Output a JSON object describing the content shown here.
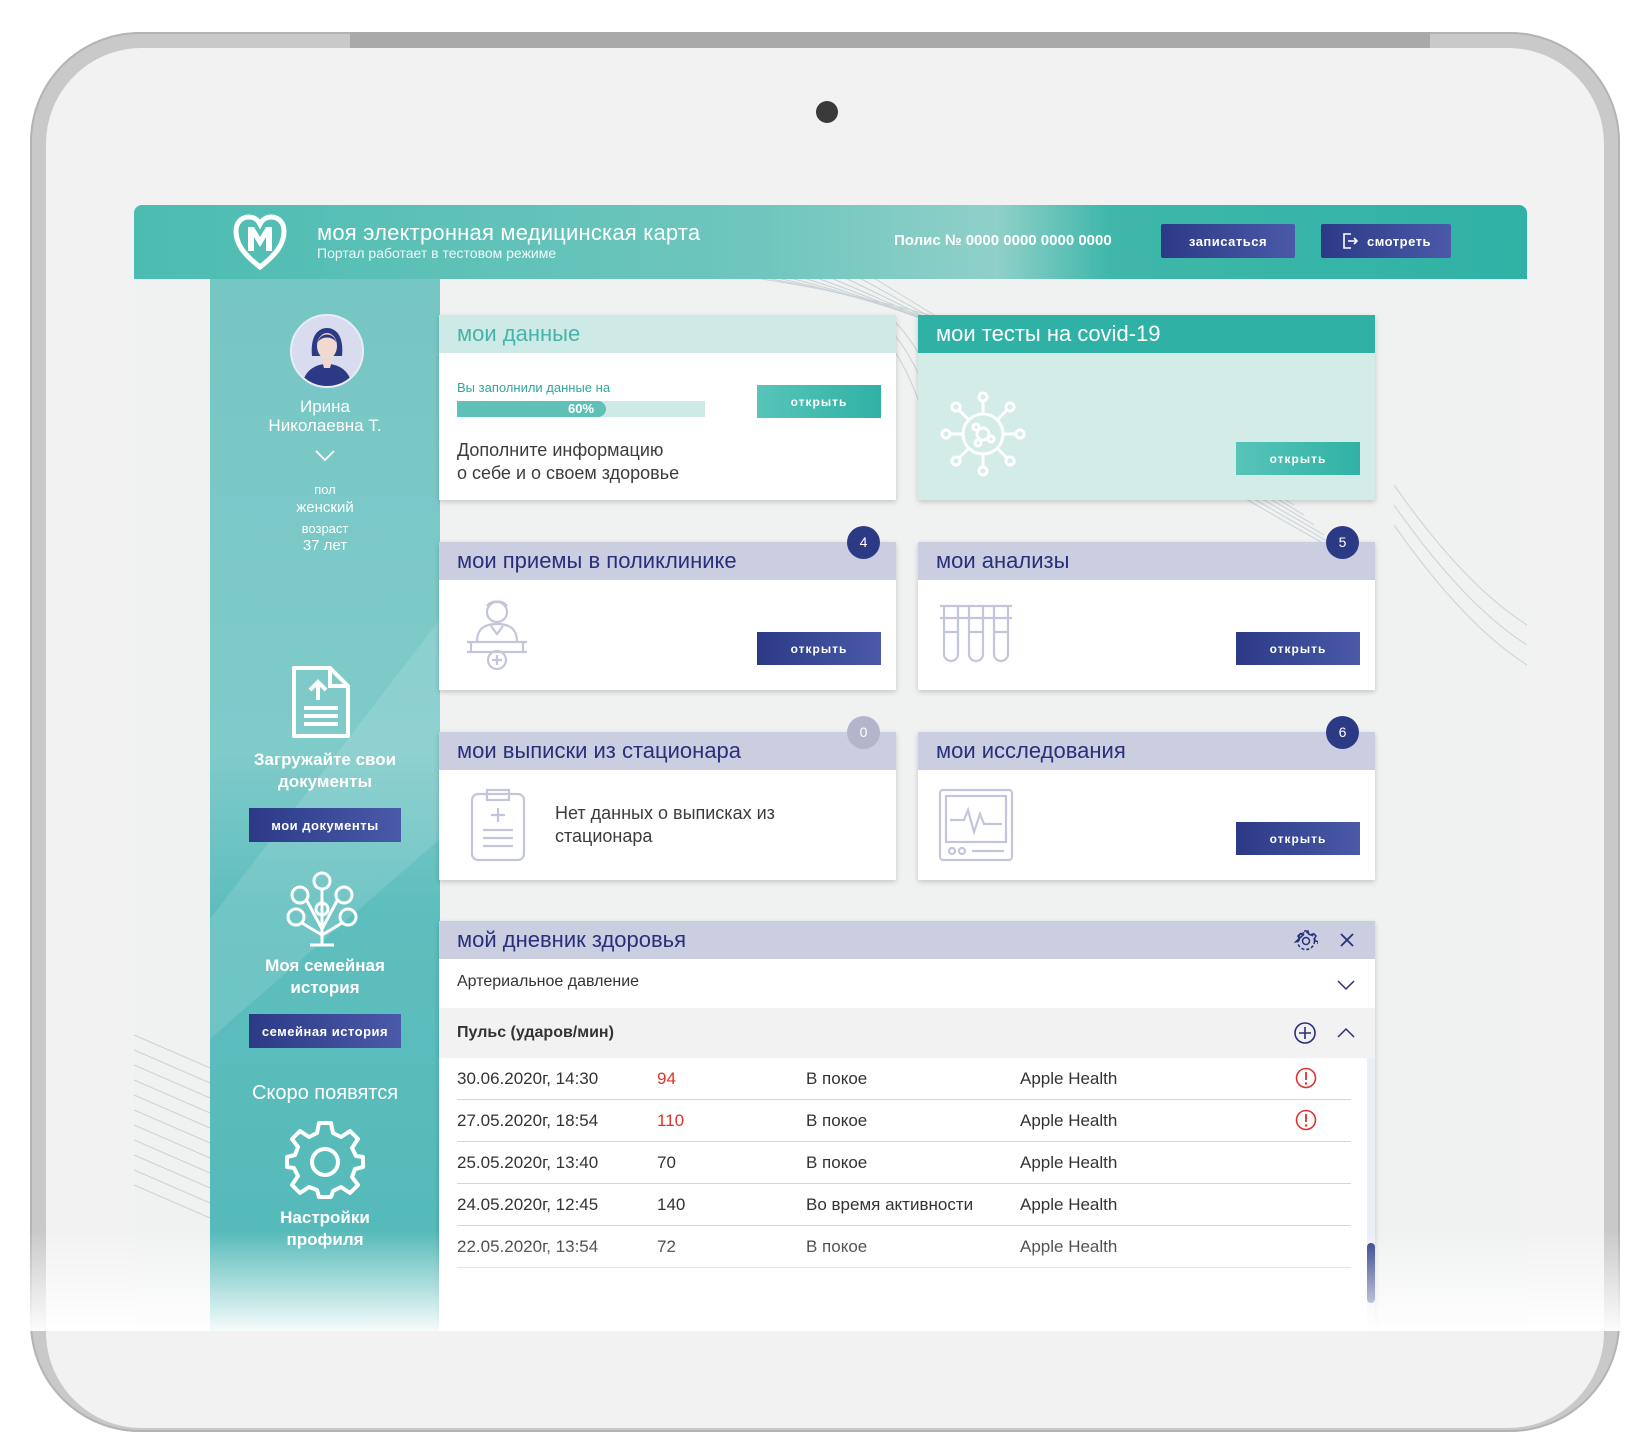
{
  "header": {
    "title": "моя электронная медицинская карта",
    "subtitle": "Портал работает в тестовом режиме",
    "policy": "Полис № 0000 0000 0000 0000",
    "signup_label": "записаться",
    "view_label": "смотреть"
  },
  "sidebar": {
    "user_name_line1": "Ирина",
    "user_name_line2": "Николаевна Т.",
    "sex_label": "пол",
    "sex_value": "женский",
    "age_label": "возраст",
    "age_value": "37 лет",
    "upload_title_line1": "Загружайте свои",
    "upload_title_line2": "документы",
    "documents_button": "мои документы",
    "family_title_line1": "Моя семейная",
    "family_title_line2": "история",
    "family_button": "семейная история",
    "coming_soon": "Скоро появятся",
    "settings_line1": "Настройки",
    "settings_line2": "профиля"
  },
  "cards": {
    "my_data": {
      "title": "мои данные",
      "progress_label": "Вы заполнили данные на",
      "progress_value": 60,
      "progress_text": "60%",
      "text_line1": "Дополните информацию",
      "text_line2": "о себе и о своем здоровье",
      "button": "открыть"
    },
    "covid": {
      "title": "мои тесты на covid-19",
      "button": "открыть"
    },
    "appointments": {
      "title": "мои приемы в поликлинике",
      "badge": "4",
      "button": "открыть"
    },
    "analyses": {
      "title": "мои анализы",
      "badge": "5",
      "button": "открыть"
    },
    "discharges": {
      "title": "мои выписки из стационара",
      "badge": "0",
      "text_line1": "Нет данных о выписках из",
      "text_line2": "стационара"
    },
    "research": {
      "title": "мои исследования",
      "badge": "6",
      "button": "открыть"
    }
  },
  "diary": {
    "title": "мой дневник здоровья",
    "section1": "Артериальное давление",
    "section2": "Пульс (ударов/мин)",
    "rows": [
      {
        "date": "30.06.2020г, 14:30",
        "value": "94",
        "state": "В покое",
        "source": "Apple Health",
        "warning": true
      },
      {
        "date": "27.05.2020г, 18:54",
        "value": "110",
        "state": "В покое",
        "source": "Apple Health",
        "warning": true
      },
      {
        "date": "25.05.2020г, 13:40",
        "value": "70",
        "state": "В покое",
        "source": "Apple Health",
        "warning": false
      },
      {
        "date": "24.05.2020г, 12:45",
        "value": "140",
        "state": "Во время активности",
        "source": "Apple Health",
        "warning": false
      },
      {
        "date": "22.05.2020г, 13:54",
        "value": "72",
        "state": "В покое",
        "source": "Apple Health",
        "warning": false
      }
    ]
  },
  "colors": {
    "teal": "#2fb2a5",
    "navy": "#2c3a86",
    "warning_red": "#e0322b",
    "card_head": "#cbcde0"
  }
}
